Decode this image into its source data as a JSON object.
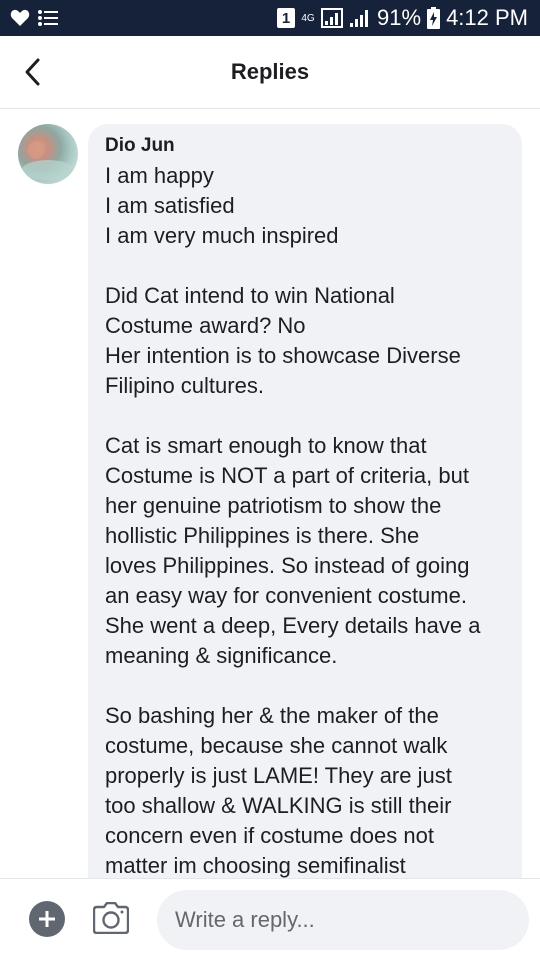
{
  "status_bar": {
    "sim_badge": "1",
    "network": "4G",
    "battery": "91%",
    "time": "4:12 PM"
  },
  "header": {
    "title": "Replies"
  },
  "comment": {
    "author": "Dio Jun",
    "lines": [
      "I am happy",
      "I am satisfied",
      "I am very much inspired",
      "",
      "Did Cat intend to win National",
      "Costume award? No",
      "Her intention is to showcase Diverse",
      "Filipino cultures.",
      "",
      "Cat is smart enough to know that",
      "Costume is NOT a part of criteria, but",
      "her genuine patriotism to show the",
      "hollistic Philippines is there. She",
      "loves Philippines. So instead of going",
      "an easy way for convenient costume.",
      "She went a deep, Every details have a",
      "meaning & significance.",
      "",
      "So bashing her & the maker of the",
      "costume, because she cannot walk",
      "properly is just LAME! They are just",
      "too shallow & WALKING is still their",
      "concern even if costume does not",
      "matter im choosing semifinalist"
    ]
  },
  "composer": {
    "placeholder": "Write a reply..."
  },
  "colors": {
    "status_bar_bg": "#16213a",
    "bubble_bg": "#f0f2f5",
    "icon_gray": "#606770"
  }
}
